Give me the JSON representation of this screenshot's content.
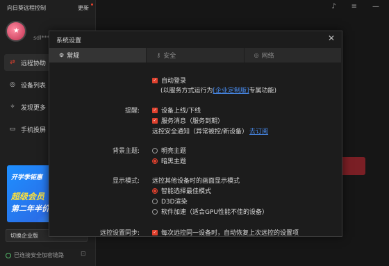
{
  "app": {
    "title": "向日葵远程控制",
    "update": "更新",
    "user_name": "sdl***",
    "nav": [
      {
        "label": "远程协助",
        "icon": "remote-assist-icon"
      },
      {
        "label": "设备列表",
        "icon": "device-list-icon"
      },
      {
        "label": "发现更多",
        "icon": "discover-icon"
      },
      {
        "label": "手机投屏",
        "icon": "screen-cast-icon"
      }
    ],
    "promo": {
      "line1": "开学季钜惠",
      "line2": "超级会员",
      "line3": "第二年半价"
    },
    "switch_enterprise": "切换企业版",
    "status": "已连接安全加密链路"
  },
  "dialog": {
    "title": "系统设置",
    "tabs": [
      {
        "label": "常规",
        "icon": "gear-icon"
      },
      {
        "label": "安全",
        "icon": "key-icon"
      },
      {
        "label": "网络",
        "icon": "network-icon"
      }
    ],
    "autostart": {
      "label": "自动登录",
      "hint_prefix": "(以服务方式运行为",
      "hint_link": "[企业定制版]",
      "hint_suffix": "专属功能)"
    },
    "reminders": {
      "label": "提醒:",
      "device_online": "设备上线/下线",
      "service_msg": "服务消息（服务到期）",
      "security_notice": "远控安全通知（异常被控/新设备）",
      "subscribe_link": "去订阅"
    },
    "theme": {
      "label": "背景主题:",
      "light": "明亮主题",
      "dark": "暗黑主题"
    },
    "display": {
      "label": "显示模式:",
      "desc": "远控其他设备时的画面显示模式",
      "smart": "智能选择最佳模式",
      "d3d": "D3D渲染",
      "soft": "软件加速（适合GPU性能不佳的设备）"
    },
    "sync": {
      "label": "远控设置同步:",
      "desc": "每次远控同一设备时，自动恢复上次远控的设置项"
    }
  }
}
